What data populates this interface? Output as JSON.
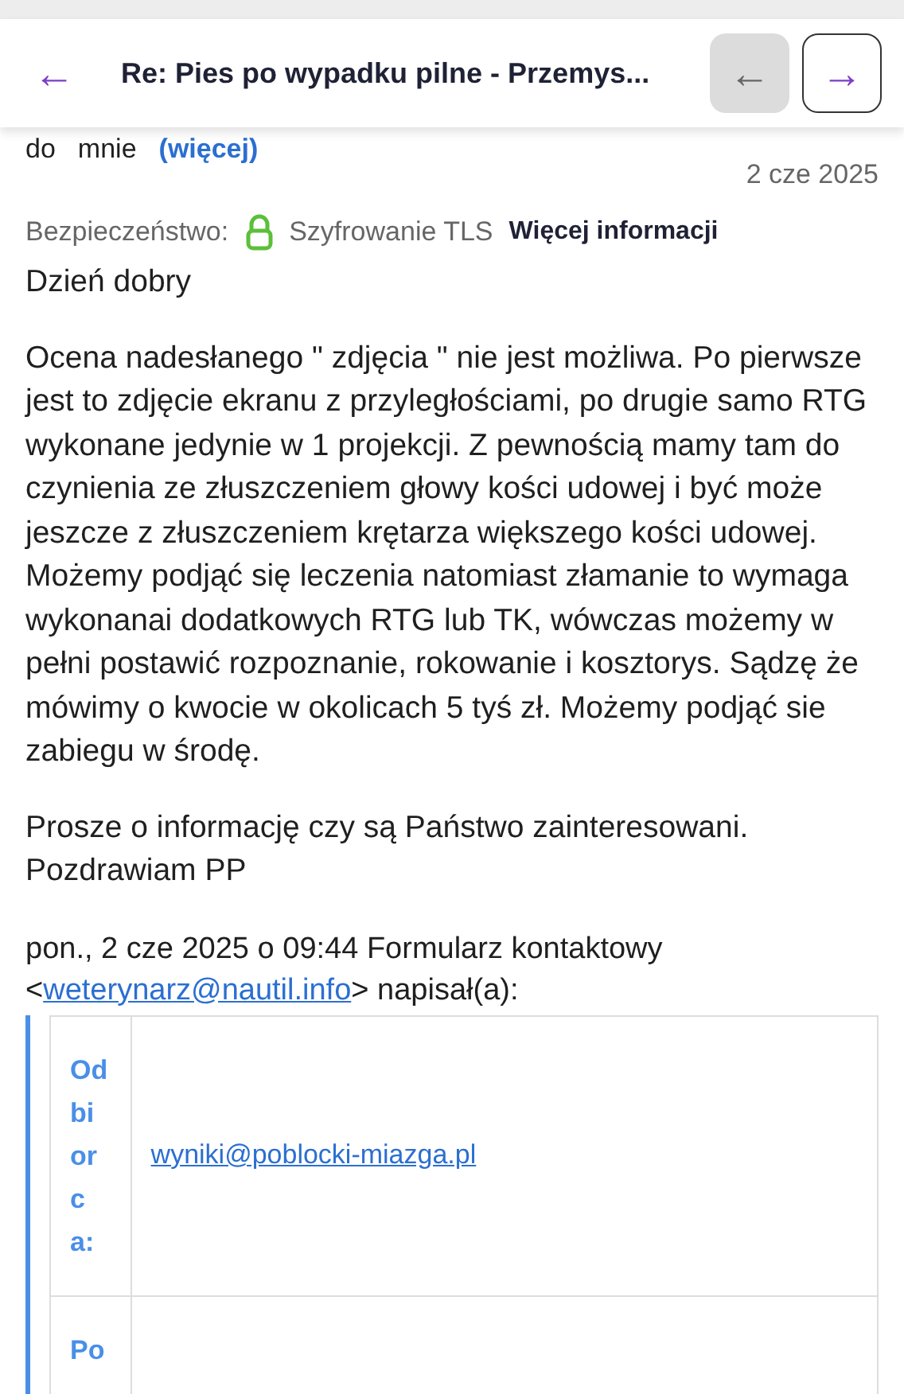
{
  "header": {
    "title": "Re: Pies po wypadku pilne - Przemys...",
    "back_icon": "←",
    "prev_icon": "←",
    "next_icon": "→"
  },
  "recipients": {
    "prefix": "do",
    "name": "mnie",
    "more": "(więcej)"
  },
  "date": "2 cze 2025",
  "security": {
    "label": "Bezpieczeństwo:",
    "value": "Szyfrowanie TLS",
    "link": "Więcej informacji"
  },
  "body": [
    "Dzień dobry",
    "Ocena nadesłanego \" zdjęcia \" nie jest możliwa. Po pierwsze jest to zdjęcie ekranu z przyległościami, po drugie samo RTG wykonane jedynie w 1 projekcji. Z pewnością mamy tam do czynienia ze złuszczeniem głowy kości udowej i być może jeszcze z złuszczeniem krętarza większego kości udowej.  Możemy podjąć się leczenia natomiast złamanie to wymaga wykonanai dodatkowych RTG lub TK, wówczas możemy w pełni postawić rozpoznanie, rokowanie i kosztorys. Sądzę że mówimy o kwocie w okolicach 5 tyś zł. Możemy podjąć sie zabiegu w środę.",
    "Prosze o informację czy są Państwo zainteresowani.\nPozdrawiam PP"
  ],
  "quote_header": {
    "text": "pon., 2 cze 2025 o 09:44 Formularz kontaktowy",
    "open": "<",
    "email": "weterynarz@nautil.info",
    "close": "> napisał(a):"
  },
  "quote_table": [
    {
      "label": "Odbiorca:",
      "value": "wyniki@poblocki-miazga.pl"
    },
    {
      "label": "Po"
    }
  ]
}
